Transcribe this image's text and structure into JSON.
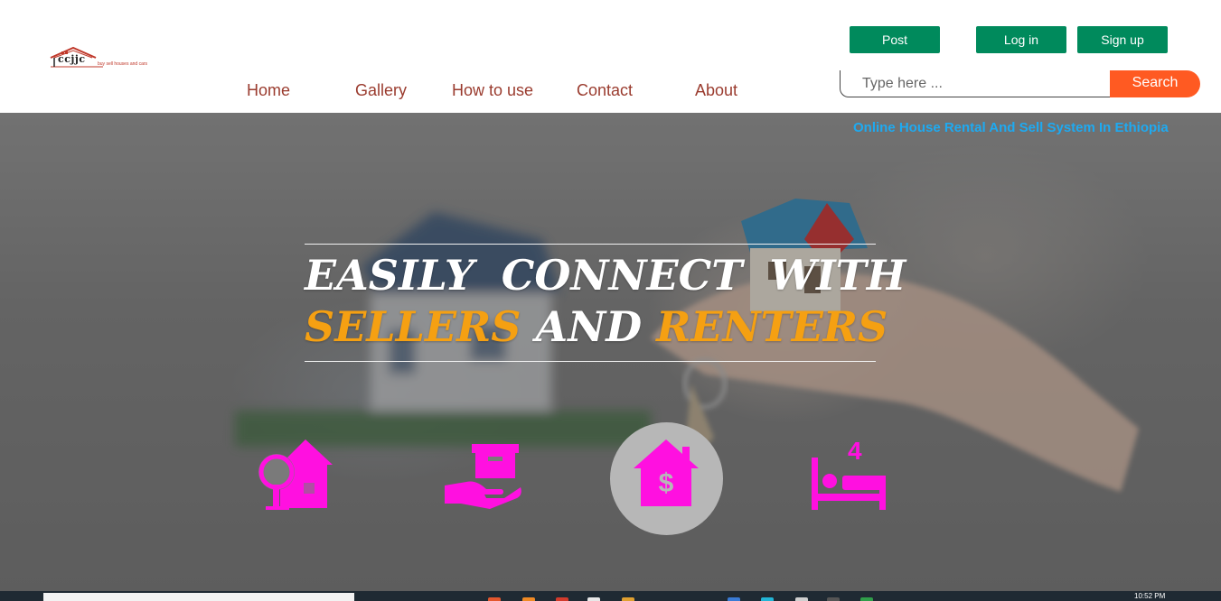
{
  "header": {
    "logo": {
      "word": "ccjjc",
      "tagline": "buy sell houses and cars"
    },
    "nav": [
      {
        "label": "Home"
      },
      {
        "label": "Gallery"
      },
      {
        "label": "How to use"
      },
      {
        "label": "Contact"
      },
      {
        "label": "About"
      }
    ],
    "buttons": {
      "post": "Post",
      "login": "Log in",
      "signup": "Sign up"
    },
    "search": {
      "placeholder": "Type here ...",
      "value": "",
      "button_label": "Search"
    }
  },
  "hero": {
    "tagline": "Online House Rental And Sell System In Ethiopia",
    "headline_line1": "EASILY  CONNECT  WITH",
    "headline_line2": {
      "word1": "SELLERS",
      "word2": "AND",
      "word3": "RENTERS"
    },
    "features": [
      {
        "icon": "house-with-tree-icon"
      },
      {
        "icon": "hand-holding-box-icon"
      },
      {
        "icon": "house-dollar-icon"
      },
      {
        "icon": "bed-four-icon"
      }
    ],
    "bed_count": "4"
  },
  "taskbar": {
    "clock": "10:52 PM"
  },
  "colors": {
    "nav_text": "#9a3b2e",
    "button_green": "#008a5c",
    "search_orange": "#ff5a22",
    "tagline_blue": "#1eaaf1",
    "headline_accent": "#f5a012",
    "icon_magenta": "#ff10e0"
  }
}
